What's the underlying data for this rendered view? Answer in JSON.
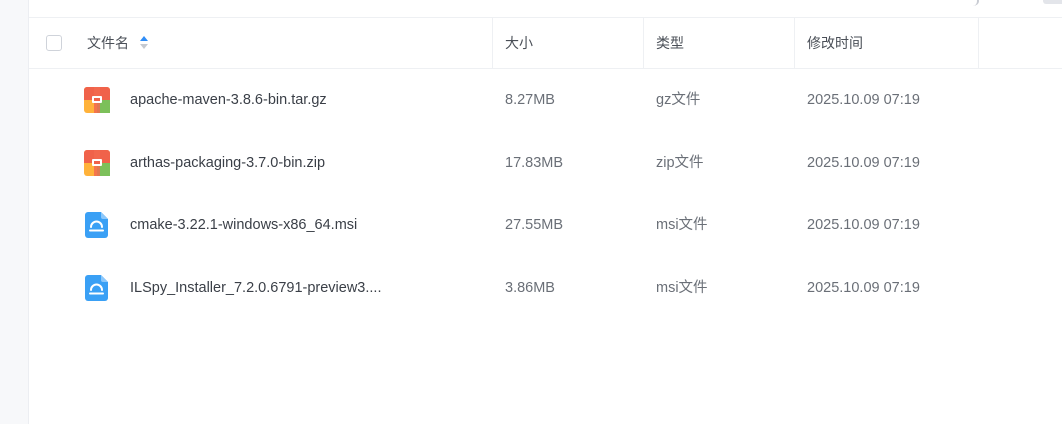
{
  "table": {
    "columns": {
      "name": "文件名",
      "size": "大小",
      "type": "类型",
      "modified": "修改时间"
    },
    "sort": {
      "column": "name",
      "direction": "ascending"
    },
    "rows": [
      {
        "name": "apache-maven-3.8.6-bin.tar.gz",
        "size": "8.27MB",
        "type": "gz文件",
        "modified": "2025.10.09 07:19",
        "icon": "archive-icon"
      },
      {
        "name": "arthas-packaging-3.7.0-bin.zip",
        "size": "17.83MB",
        "type": "zip文件",
        "modified": "2025.10.09 07:19",
        "icon": "archive-icon"
      },
      {
        "name": "cmake-3.22.1-windows-x86_64.msi",
        "size": "27.55MB",
        "type": "msi文件",
        "modified": "2025.10.09 07:19",
        "icon": "installer-icon"
      },
      {
        "name": "ILSpy_Installer_7.2.0.6791-preview3....",
        "size": "3.86MB",
        "type": "msi文件",
        "modified": "2025.10.09 07:19",
        "icon": "installer-icon"
      }
    ]
  },
  "colors": {
    "accent": "#2f8df7",
    "installer_icon": "#3aa0f5",
    "archive_top": "#f0624a",
    "archive_bottom_left": "#ffb23a",
    "archive_bottom_right": "#7cc05a"
  }
}
